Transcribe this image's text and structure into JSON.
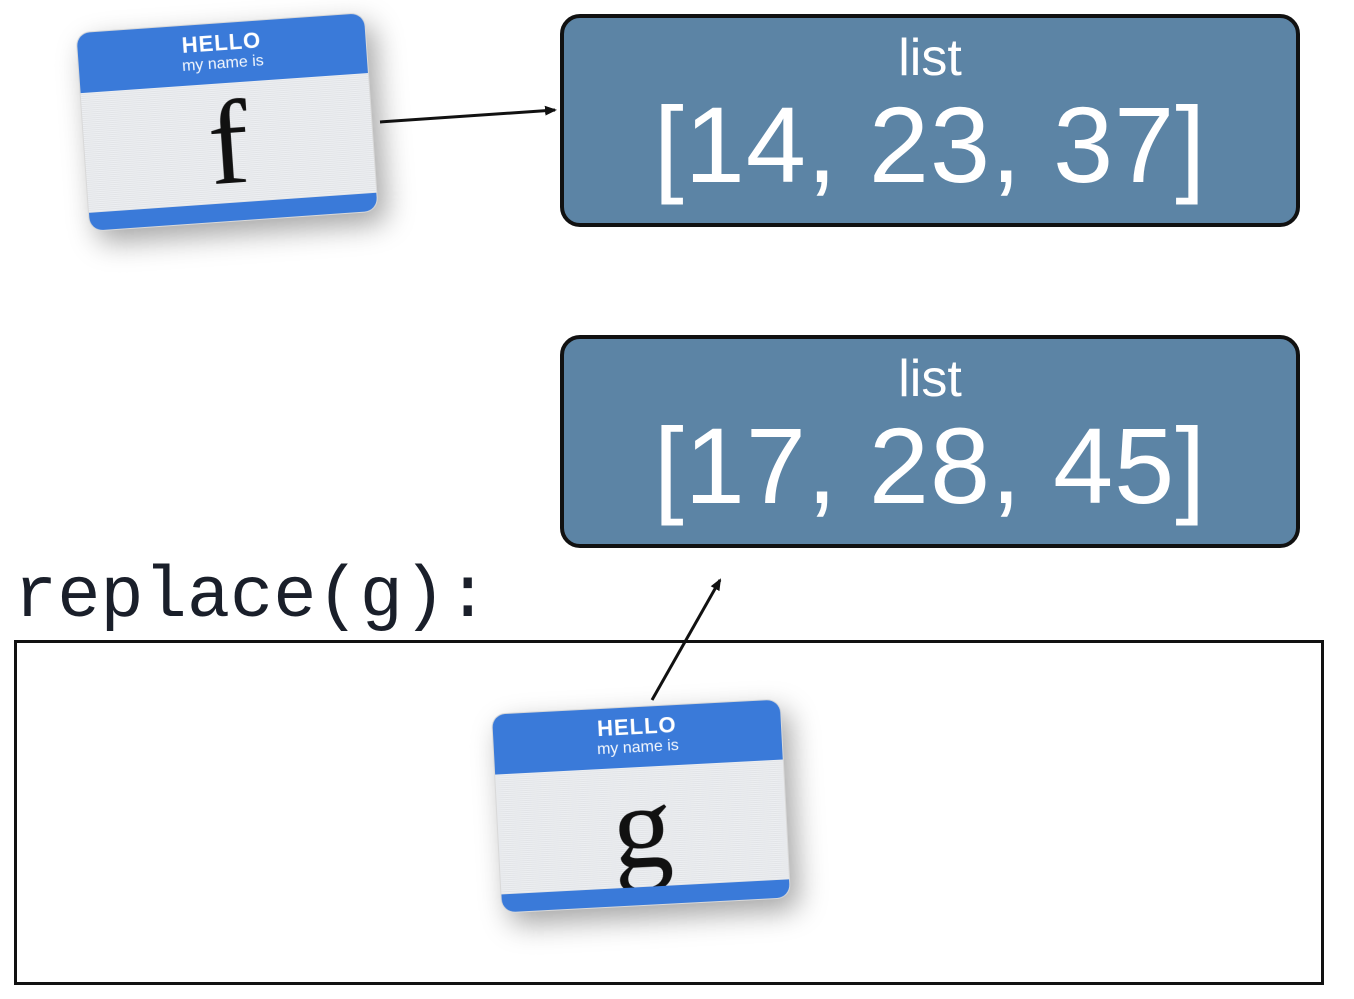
{
  "tag_f": {
    "hello": "HELLO",
    "myname": "my name is",
    "letter": "f"
  },
  "tag_g": {
    "hello": "HELLO",
    "myname": "my name is",
    "letter": "g"
  },
  "list1": {
    "type": "list",
    "value": "[14, 23, 37]"
  },
  "list2": {
    "type": "list",
    "value": "[17, 28, 45]"
  },
  "function_label": "replace(g):",
  "colors": {
    "tag_blue": "#3a7ad9",
    "box_blue": "#5c84a5",
    "ink": "#111111"
  }
}
